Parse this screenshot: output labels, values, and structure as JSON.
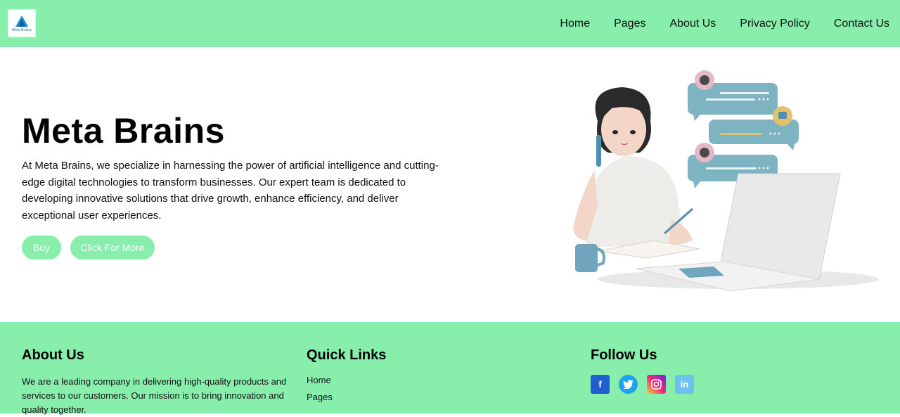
{
  "nav": {
    "logo_text": "Meta Brains",
    "links": [
      "Home",
      "Pages",
      "About Us",
      "Privacy Policy",
      "Contact Us"
    ]
  },
  "hero": {
    "title": "Meta Brains",
    "description": "At Meta Brains, we specialize in harnessing the power of artificial intelligence and cutting-edge digital technologies to transform businesses. Our expert team is dedicated to developing innovative solutions that drive growth, enhance efficiency, and deliver exceptional user experiences.",
    "buy_label": "Buy",
    "more_label": "Click For More",
    "illustration_icon": "woman-on-phone-with-laptop-illustration"
  },
  "footer": {
    "about_title": "About Us",
    "about_text": "We are a leading company in delivering high-quality products and services to our customers. Our mission is to bring innovation and quality together.",
    "links_title": "Quick Links",
    "links": [
      "Home",
      "Pages"
    ],
    "follow_title": "Follow Us",
    "social": [
      {
        "name": "facebook-icon",
        "glyph": "f"
      },
      {
        "name": "twitter-icon",
        "glyph": ""
      },
      {
        "name": "instagram-icon",
        "glyph": ""
      },
      {
        "name": "linkedin-icon",
        "glyph": "in"
      }
    ]
  },
  "colors": {
    "accent": "#88eeac",
    "background": "#ffffff",
    "text": "#111111"
  }
}
